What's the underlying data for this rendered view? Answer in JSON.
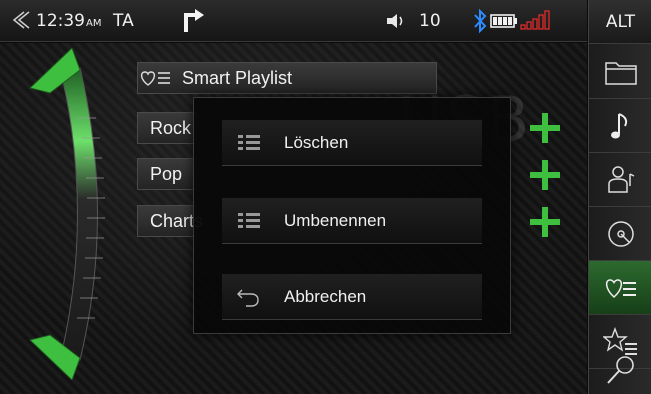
{
  "statusbar": {
    "time": "12:39",
    "ampm": "AM",
    "ta": "TA",
    "volume": "10"
  },
  "sidebar": {
    "alt_label": "ALT",
    "items": [
      {
        "icon": "folder-icon"
      },
      {
        "icon": "music-note-icon"
      },
      {
        "icon": "artist-icon"
      },
      {
        "icon": "disc-icon"
      },
      {
        "icon": "smart-playlist-icon",
        "active": true
      },
      {
        "icon": "favorites-list-icon"
      },
      {
        "icon": "search-icon"
      }
    ]
  },
  "watermark": "USB",
  "list": {
    "smart_playlist": "Smart Playlist",
    "items": [
      "Rock",
      "Pop",
      "Charts"
    ]
  },
  "menu": {
    "items": [
      {
        "label": "Löschen",
        "icon": "list-icon"
      },
      {
        "label": "Umbenennen",
        "icon": "list-icon"
      },
      {
        "label": "Abbrechen",
        "icon": "back-arrow-icon"
      }
    ]
  },
  "colors": {
    "accent_green": "#3fbf3f",
    "bluetooth_blue": "#2a8cff",
    "signal_red": "#e02a2a"
  }
}
